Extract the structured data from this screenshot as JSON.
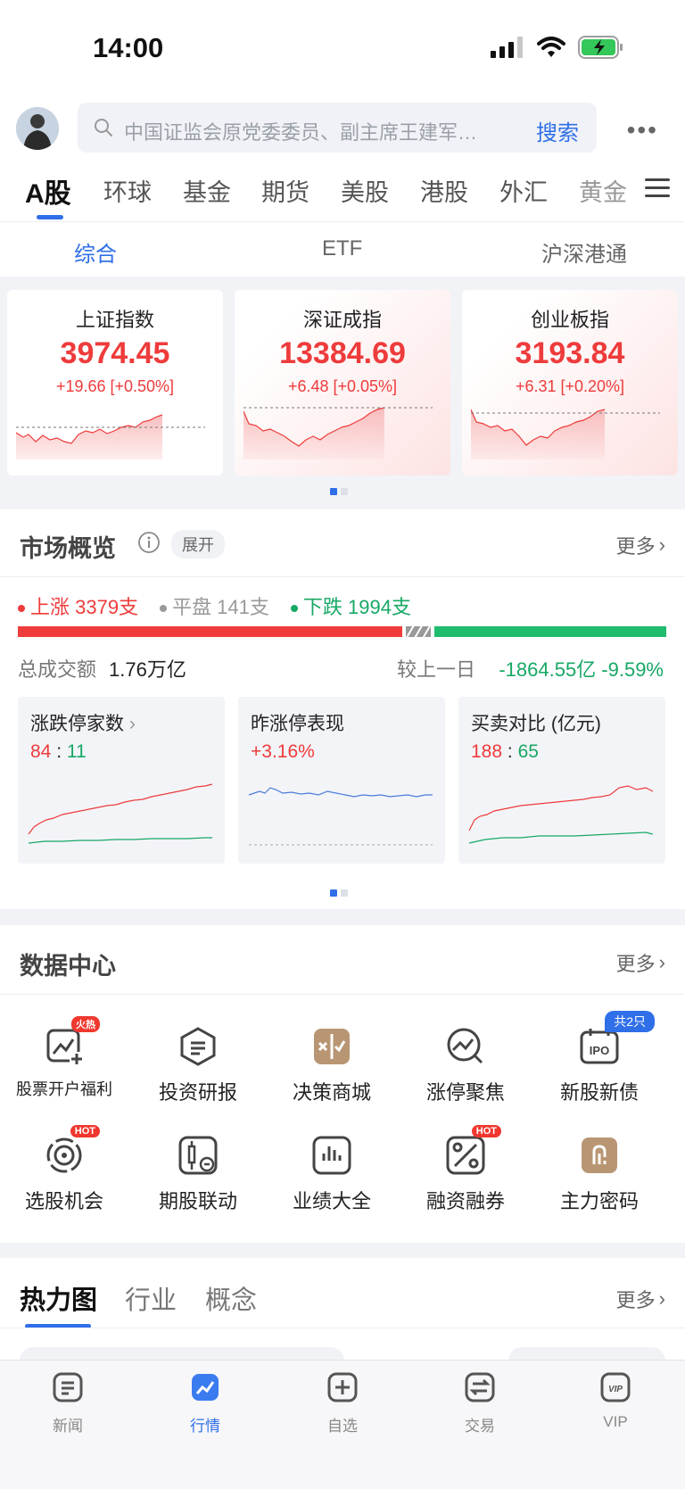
{
  "status_bar": {
    "time": "14:00"
  },
  "search": {
    "placeholder": "中国证监会原党委委员、副主席王建军…",
    "button": "搜索"
  },
  "market_tabs": [
    "A股",
    "环球",
    "基金",
    "期货",
    "美股",
    "港股",
    "外汇",
    "黄金"
  ],
  "sub_tabs": [
    "综合",
    "ETF",
    "沪深港通"
  ],
  "indices": [
    {
      "name": "上证指数",
      "value": "3974.45",
      "change": "+19.66 [+0.50%]"
    },
    {
      "name": "深证成指",
      "value": "13384.69",
      "change": "+6.48 [+0.05%]"
    },
    {
      "name": "创业板指",
      "value": "3193.84",
      "change": "+6.31 [+0.20%]"
    }
  ],
  "overview": {
    "title": "市场概览",
    "expand": "展开",
    "more": "更多",
    "up": "上涨 3379支",
    "flat": "平盘 141支",
    "down": "下跌 1994支",
    "turnover_label": "总成交额",
    "turnover_value": "1.76万亿",
    "compare_label": "较上一日",
    "compare_value": "-1864.55亿 -9.59%",
    "cards": [
      {
        "title": "涨跌停家数",
        "value_red": "84",
        "sep": ":",
        "value_green": "11"
      },
      {
        "title": "昨涨停表现",
        "value_red": "+3.16%"
      },
      {
        "title": "买卖对比 (亿元)",
        "value_red": "188",
        "sep": ":",
        "value_green": "65"
      }
    ]
  },
  "data_center": {
    "title": "数据中心",
    "more": "更多",
    "items": [
      {
        "label": "股票开户福利",
        "badge": "火热"
      },
      {
        "label": "投资研报"
      },
      {
        "label": "决策商城"
      },
      {
        "label": "涨停聚焦"
      },
      {
        "label": "新股新债",
        "badge": "共2只"
      },
      {
        "label": "选股机会",
        "badge": "HOT"
      },
      {
        "label": "期股联动"
      },
      {
        "label": "业绩大全"
      },
      {
        "label": "融资融券",
        "badge": "HOT"
      },
      {
        "label": "主力密码"
      }
    ]
  },
  "heatmap": {
    "tabs": [
      "热力图",
      "行业",
      "概念"
    ],
    "more": "更多"
  },
  "bottom_nav": [
    "新闻",
    "行情",
    "自选",
    "交易",
    "VIP"
  ],
  "colors": {
    "accent": "#2f6fe8",
    "up": "#ee3b3b",
    "down": "#17a865"
  }
}
